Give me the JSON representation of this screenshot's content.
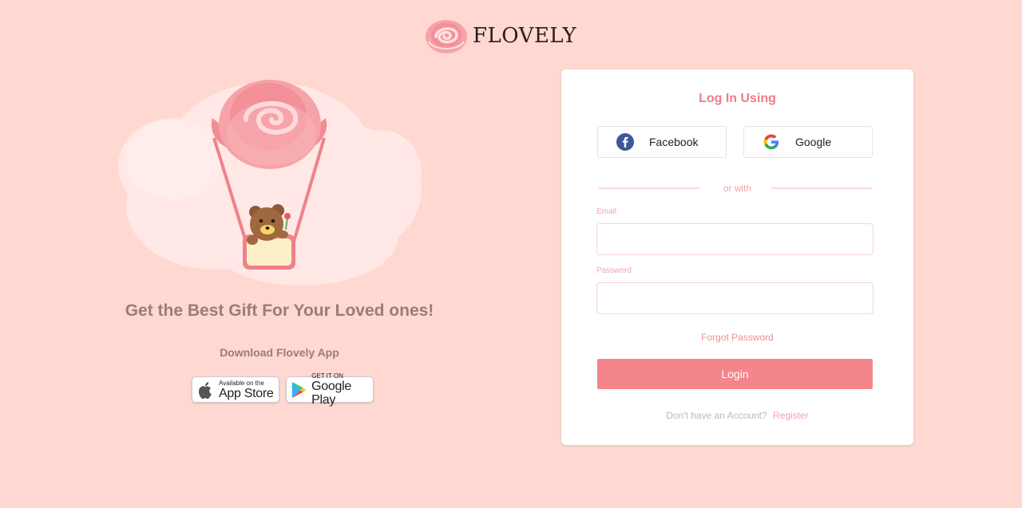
{
  "brand": {
    "name": "FLOVELY"
  },
  "hero": {
    "tagline": "Get the Best Gift For Your Loved ones!",
    "download_label": "Download Flovely App",
    "appstore": {
      "small": "Available on the",
      "big": "App Store"
    },
    "playstore": {
      "small": "GET IT ON",
      "big": "Google Play"
    }
  },
  "login": {
    "title": "Log In Using",
    "facebook_label": "Facebook",
    "google_label": "Google",
    "or_with": "or with",
    "email_label": "Email",
    "email_value": "",
    "password_label": "Password",
    "password_value": "",
    "forgot_label": "Forgot Password",
    "login_button": "Login",
    "no_account_text": "Don't have an Account?",
    "register_label": "Register"
  },
  "colors": {
    "background": "#fed8d1",
    "accent": "#f4858b",
    "text_muted": "#9a7d78",
    "facebook": "#3b5998"
  },
  "icons": [
    "rose-logo-icon",
    "apple-icon",
    "google-play-icon",
    "facebook-icon",
    "google-icon"
  ]
}
